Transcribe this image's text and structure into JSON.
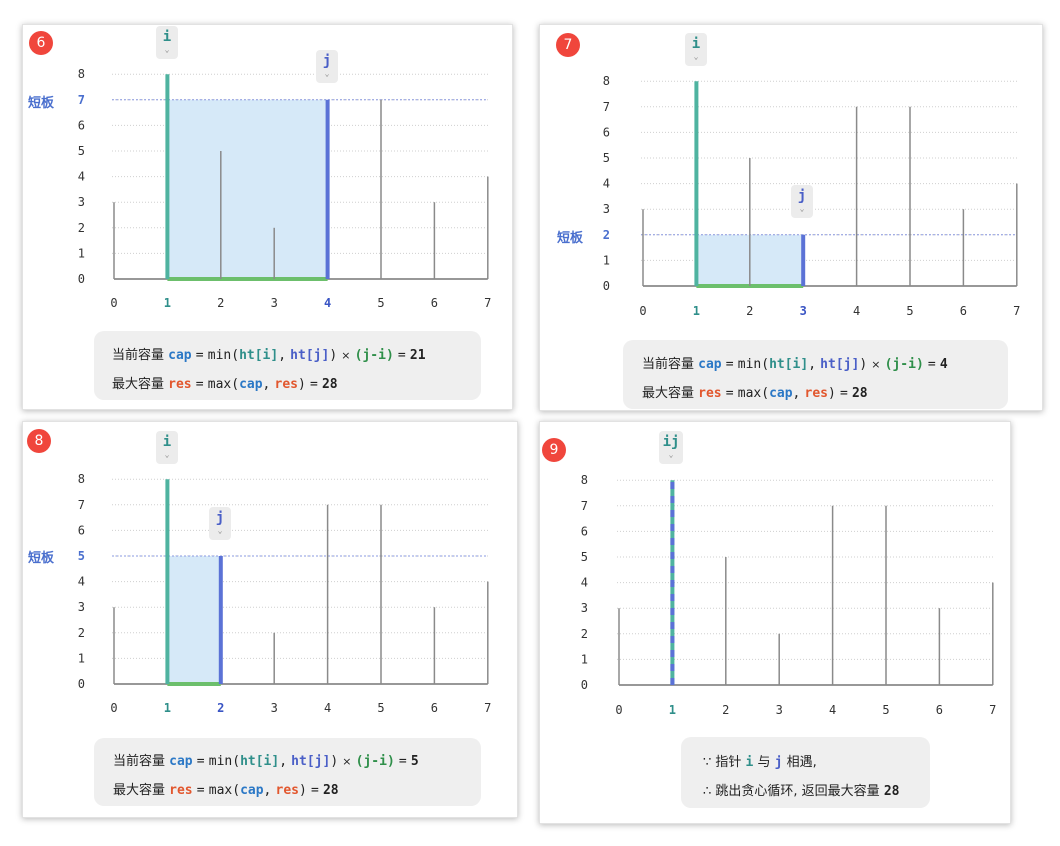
{
  "labels": {
    "short_board": "短板",
    "cur_cap": "当前容量",
    "max_cap": "最大容量",
    "cap": "cap",
    "res": "res",
    "eq": "=",
    "min_open": "min(",
    "ht_i": "ht[i]",
    "comma": ",",
    "ht_j": "ht[j]",
    "min_close": ")",
    "times": "×",
    "ji": "(j-i)",
    "max_open": "max(",
    "max_close": ")",
    "because": "∵ 指针",
    "and": "与",
    "meet": "相遇,",
    "therefore": "∴ 跳出贪心循环, 返回最大容量"
  },
  "heights": [
    3,
    8,
    5,
    2,
    7,
    7,
    3,
    4
  ],
  "y_ticks": [
    "0",
    "1",
    "2",
    "3",
    "4",
    "5",
    "6",
    "7",
    "8"
  ],
  "x_ticks": [
    "0",
    "1",
    "2",
    "3",
    "4",
    "5",
    "6",
    "7"
  ],
  "colors": {
    "i": "#4fb3a0",
    "j": "#5b72d6",
    "water": "#d6e9f8",
    "base": "#6cbf6c",
    "short": "#4a6fce",
    "step": "#f0463c"
  },
  "panels": [
    {
      "step": "6",
      "i": 1,
      "j": 4,
      "short_h": 7,
      "ptr_i": "i",
      "ptr_j": "j",
      "cap": "21",
      "res": "28"
    },
    {
      "step": "7",
      "i": 1,
      "j": 3,
      "short_h": 2,
      "ptr_i": "i",
      "ptr_j": "j",
      "cap": "4",
      "res": "28"
    },
    {
      "step": "8",
      "i": 1,
      "j": 2,
      "short_h": 5,
      "ptr_i": "i",
      "ptr_j": "j",
      "cap": "5",
      "res": "28"
    },
    {
      "step": "9",
      "i": 1,
      "j": 1,
      "ptr_ij": "ij",
      "ptr_i": "i",
      "ptr_j": "j",
      "res": "28"
    }
  ]
}
